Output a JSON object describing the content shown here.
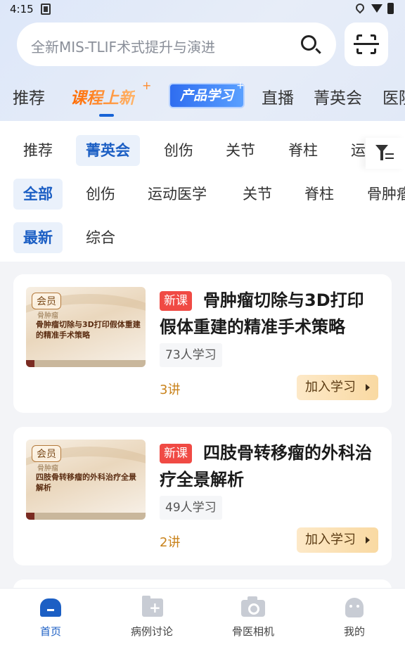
{
  "status_bar": {
    "time": "4:15"
  },
  "search": {
    "placeholder": "全新MIS-TLIF术式提升与演进"
  },
  "top_tabs": [
    "推荐",
    "课程上新",
    "产品学习",
    "直播",
    "菁英会",
    "医院"
  ],
  "filter_row1": [
    "推荐",
    "菁英会",
    "创伤",
    "关节",
    "脊柱",
    "运动"
  ],
  "filter_row2": [
    "全部",
    "创伤",
    "运动医学",
    "关节",
    "脊柱",
    "骨肿瘤"
  ],
  "filter_row3": [
    "最新",
    "综合"
  ],
  "courses": [
    {
      "badge": "会员",
      "thumb_category": "骨肿瘤",
      "thumb_title": "骨肿瘤切除与3D打印假体重建的精准手术策略",
      "tag": "新课",
      "title": "骨肿瘤切除与3D打印假体重建的精准手术策略",
      "learners": "73人学习",
      "lessons": "3讲",
      "action": "加入学习"
    },
    {
      "badge": "会员",
      "thumb_category": "骨肿瘤",
      "thumb_title": "四肢骨转移瘤的外科治疗全景解析",
      "tag": "新课",
      "title": "四肢骨转移瘤的外科治疗全景解析",
      "learners": "49人学习",
      "lessons": "2讲",
      "action": "加入学习"
    }
  ],
  "bottom_nav": [
    "首页",
    "病例讨论",
    "骨医相机",
    "我的"
  ],
  "colors": {
    "accent": "#1c5fc4",
    "orange": "#ff7a1a",
    "new_tag": "#f04a44"
  }
}
